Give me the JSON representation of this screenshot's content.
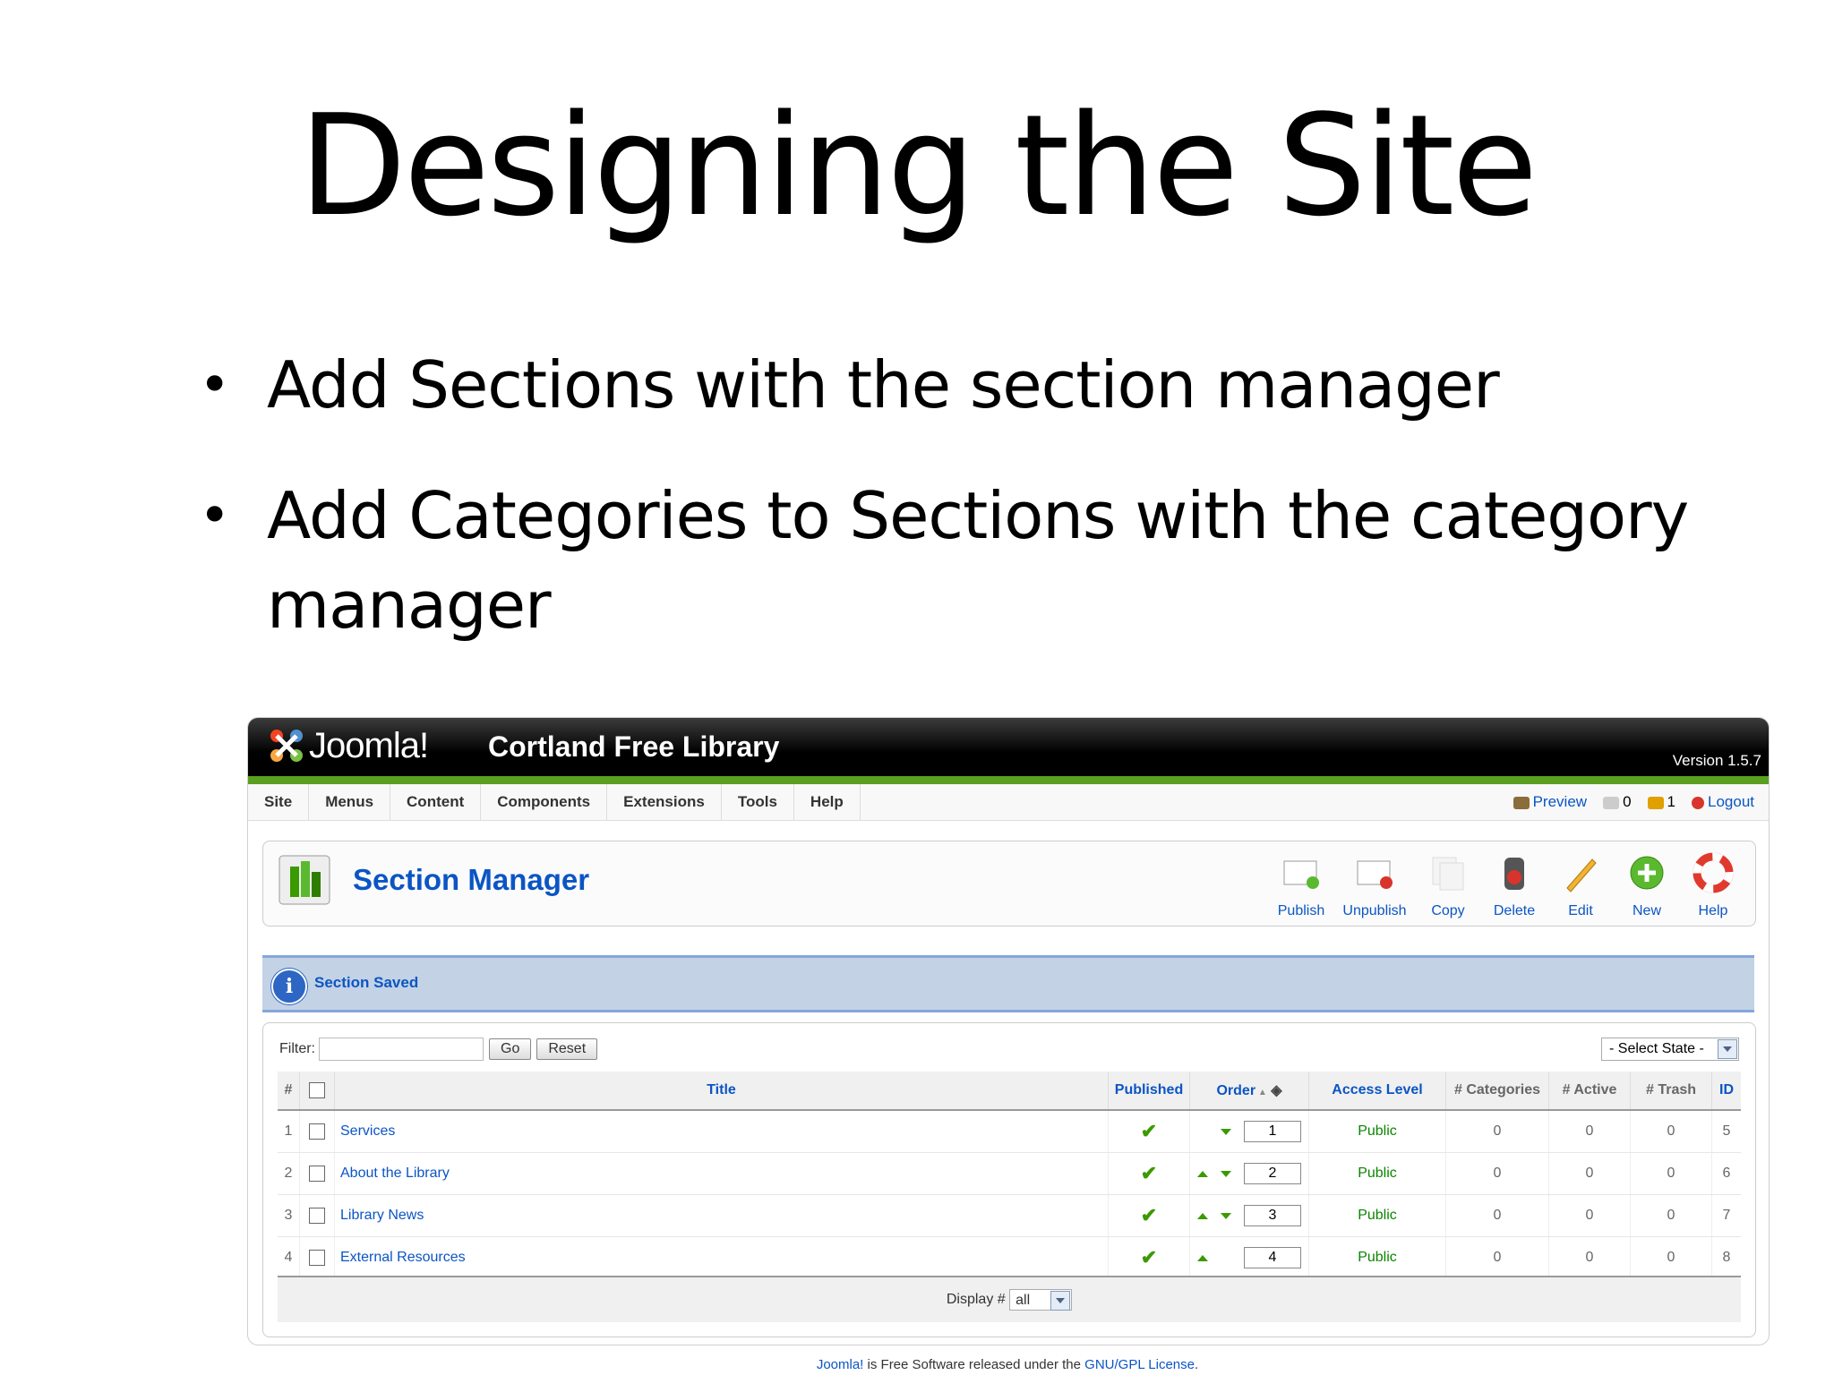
{
  "slide": {
    "title": "Designing the Site",
    "bullets": [
      "Add Sections with the section manager",
      "Add Categories to Sections with the category manager"
    ],
    "bullet_char": "•"
  },
  "joomla": {
    "logo_text": "Joomla!",
    "site_name": "Cortland Free Library",
    "version": "Version 1.5.7",
    "menu": [
      "Site",
      "Menus",
      "Content",
      "Components",
      "Extensions",
      "Tools",
      "Help"
    ],
    "status": {
      "preview": "Preview",
      "messages": "0",
      "users": "1",
      "logout": "Logout"
    },
    "page_title": "Section Manager",
    "toolbar": [
      "Publish",
      "Unpublish",
      "Copy",
      "Delete",
      "Edit",
      "New",
      "Help"
    ],
    "message": "Section Saved",
    "filter": {
      "label": "Filter:",
      "go": "Go",
      "reset": "Reset",
      "state_select": "- Select State -"
    },
    "columns": [
      "#",
      "",
      "Title",
      "Published",
      "Order",
      "Access Level",
      "# Categories",
      "# Active",
      "# Trash",
      "ID"
    ],
    "rows": [
      {
        "num": "1",
        "title": "Services",
        "order": "1",
        "access": "Public",
        "categories": "0",
        "active": "0",
        "trash": "0",
        "id": "5"
      },
      {
        "num": "2",
        "title": "About the Library",
        "order": "2",
        "access": "Public",
        "categories": "0",
        "active": "0",
        "trash": "0",
        "id": "6"
      },
      {
        "num": "3",
        "title": "Library News",
        "order": "3",
        "access": "Public",
        "categories": "0",
        "active": "0",
        "trash": "0",
        "id": "7"
      },
      {
        "num": "4",
        "title": "External Resources",
        "order": "4",
        "access": "Public",
        "categories": "0",
        "active": "0",
        "trash": "0",
        "id": "8"
      }
    ],
    "display": {
      "label": "Display #",
      "value": "all"
    },
    "footer": {
      "brand": "Joomla!",
      "text": " is Free Software released under the ",
      "license": "GNU/GPL License",
      "end": "."
    },
    "colors": {
      "link": "#0b55c4",
      "accent_green": "#5a9f1e",
      "message_bg": "#c3d2e5"
    }
  }
}
